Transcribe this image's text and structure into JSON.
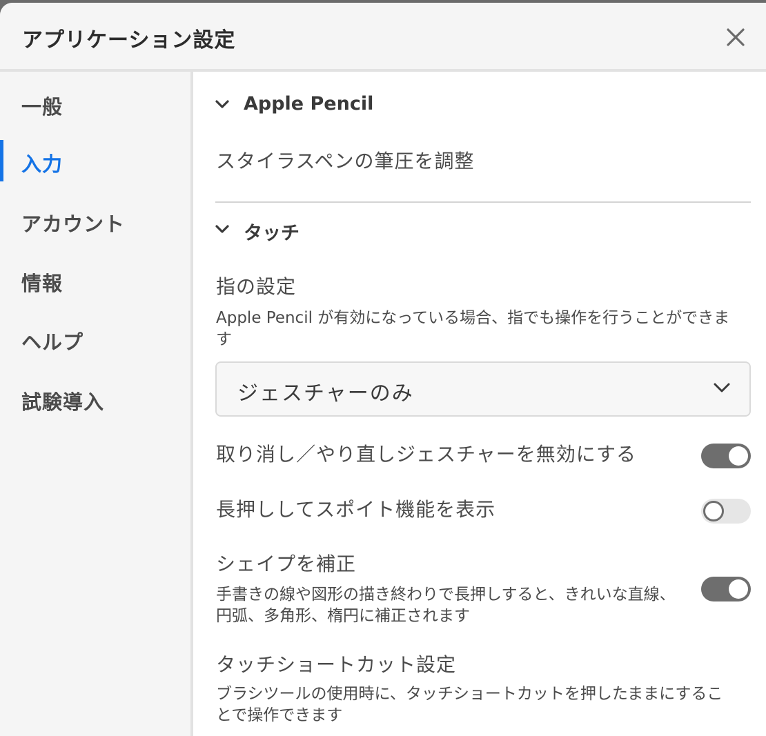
{
  "dialog": {
    "title": "アプリケーション設定",
    "close_icon": "close-icon"
  },
  "sidebar": {
    "items": [
      {
        "label": "一般",
        "active": false
      },
      {
        "label": "入力",
        "active": true
      },
      {
        "label": "アカウント",
        "active": false
      },
      {
        "label": "情報",
        "active": false
      },
      {
        "label": "ヘルプ",
        "active": false
      },
      {
        "label": "試験導入",
        "active": false
      }
    ],
    "accent_color": "#1473e6"
  },
  "main": {
    "apple_pencil": {
      "title": "Apple Pencil",
      "pressure_label": "スタイラスペンの筆圧を調整"
    },
    "touch": {
      "title": "タッチ",
      "finger": {
        "label": "指の設定",
        "description": "Apple Pencil が有効になっている場合、指でも操作を行うことができます",
        "selected_option": "ジェスチャーのみ"
      },
      "undo_redo": {
        "label": "取り消し／やり直しジェスチャーを無効にする",
        "enabled": true
      },
      "eyedropper": {
        "label": "長押ししてスポイト機能を表示",
        "enabled": false
      },
      "shape_correction": {
        "label": "シェイプを補正",
        "description": "手書きの線や図形の描き終わりで長押しすると、きれいな直線、円弧、多角形、楕円に補正されます",
        "enabled": true
      },
      "touch_shortcut": {
        "label": "タッチショートカット設定",
        "description": "ブラシツールの使用時に、タッチショートカットを押したままにすることで操作できます"
      }
    }
  }
}
